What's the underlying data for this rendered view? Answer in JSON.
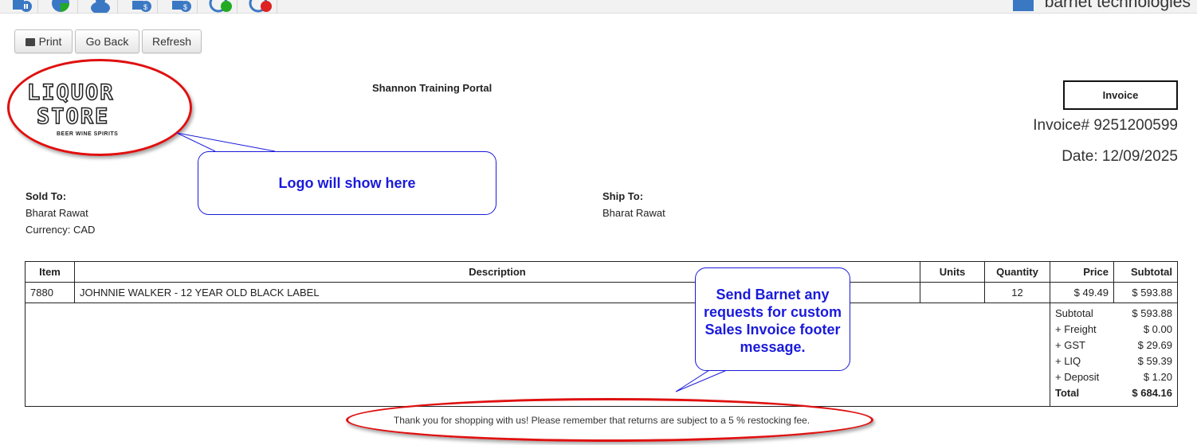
{
  "toolbar_icons": [
    {
      "name": "report-icon",
      "color": "#3b78c4"
    },
    {
      "name": "pie-chart-icon",
      "color": "#3b78c4"
    },
    {
      "name": "user-icon",
      "color": "#3b78c4"
    },
    {
      "name": "purchase-icon",
      "color": "#3b78c4"
    },
    {
      "name": "sales-icon",
      "color": "#3b78c4"
    },
    {
      "name": "clock-in-icon",
      "color": "#22aa22"
    },
    {
      "name": "clock-out-icon",
      "color": "#dd2222"
    }
  ],
  "brand": "barnet technologies",
  "buttons": {
    "print": "Print",
    "go_back": "Go Back",
    "refresh": "Refresh"
  },
  "logo": {
    "line1": "LIQUOR",
    "line2": "STORE",
    "sub": "BEER WINE SPIRITS"
  },
  "company": "Shannon Training Portal",
  "invoice": {
    "label": "Invoice",
    "number": "Invoice# 9251200599",
    "date": "Date: 12/09/2025"
  },
  "sold_to": {
    "heading": "Sold To:",
    "name": "Bharat Rawat",
    "currency": "Currency: CAD"
  },
  "ship_to": {
    "heading": "Ship To:",
    "name": "Bharat Rawat"
  },
  "table": {
    "headers": [
      "Item",
      "Description",
      "Units",
      "Quantity",
      "Price",
      "Subtotal"
    ],
    "rows": [
      {
        "item": "7880",
        "description": "JOHNNIE WALKER - 12 YEAR OLD BLACK LABEL",
        "units": "",
        "quantity": "12",
        "price": "$ 49.49",
        "subtotal": "$ 593.88"
      }
    ]
  },
  "totals": [
    {
      "label": "Subtotal",
      "value": "$ 593.88"
    },
    {
      "label": "+ Freight",
      "value": "$ 0.00"
    },
    {
      "label": "+ GST",
      "value": "$ 29.69"
    },
    {
      "label": "+ LIQ",
      "value": "$ 59.39"
    },
    {
      "label": "+ Deposit",
      "value": "$ 1.20"
    },
    {
      "label": "Total",
      "value": "$ 684.16"
    }
  ],
  "footer": "Thank you for shopping with us! Please remember that returns are subject to a 5 % restocking fee.",
  "callouts": {
    "logo": "Logo will show here",
    "footer": "Send Barnet any requests for custom Sales Invoice footer message."
  },
  "colors": {
    "annotation_red": "#e01010",
    "callout_blue": "#1a1adb",
    "brand_blue": "#3b78c4"
  }
}
